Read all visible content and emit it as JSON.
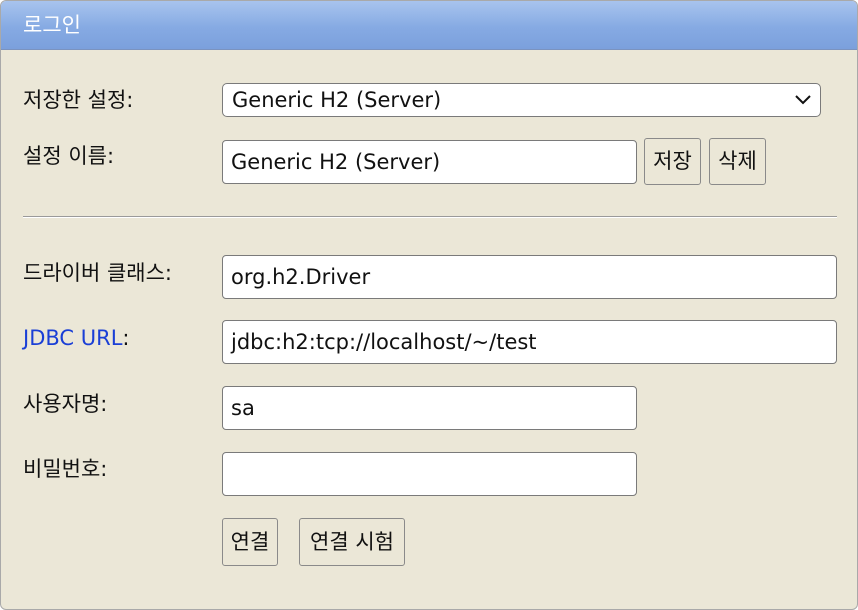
{
  "window": {
    "title": "로그인"
  },
  "saved_settings": {
    "label": "저장한 설정:",
    "selected": "Generic H2 (Server)"
  },
  "setting_name": {
    "label": "설정 이름:",
    "value": "Generic H2 (Server)",
    "save_label": "저장",
    "delete_label": "삭제"
  },
  "driver_class": {
    "label": "드라이버 클래스:",
    "value": "org.h2.Driver"
  },
  "jdbc_url": {
    "link_text": "JDBC URL",
    "suffix": ":",
    "value": "jdbc:h2:tcp://localhost/~/test"
  },
  "username": {
    "label": "사용자명:",
    "value": "sa"
  },
  "password": {
    "label": "비밀번호:",
    "value": ""
  },
  "actions": {
    "connect_label": "연결",
    "test_connection_label": "연결 시험"
  },
  "colors": {
    "panel_background": "#ebe7d7",
    "titlebar": "#86aae3",
    "link": "#1a3fd6"
  }
}
